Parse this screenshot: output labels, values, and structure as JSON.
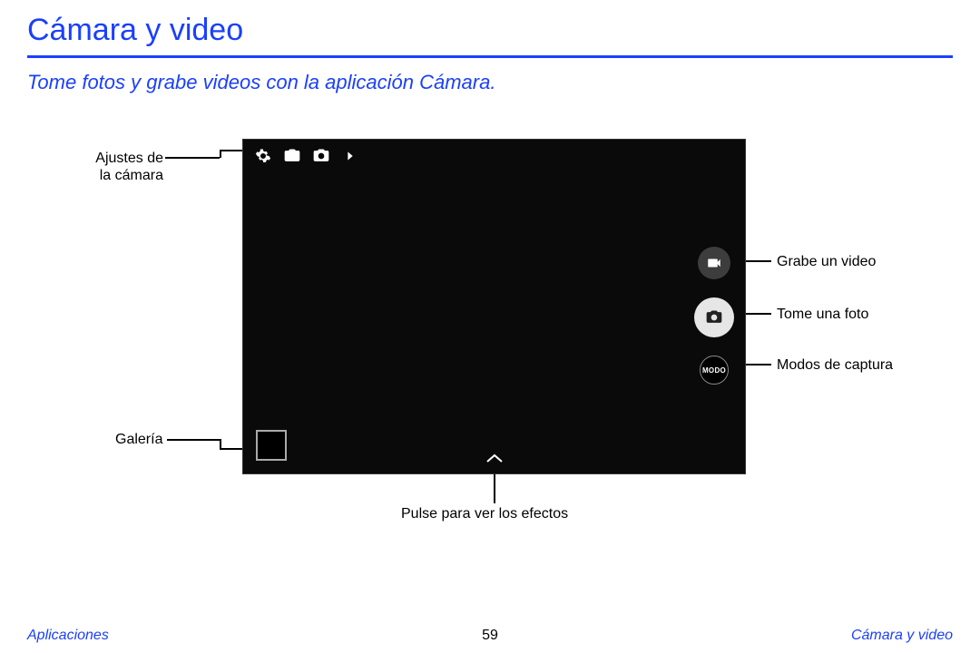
{
  "header": {
    "title": "Cámara y video",
    "subtitle": "Tome fotos y grabe videos con la aplicación Cámara."
  },
  "callouts": {
    "settings": "Ajustes de\nla cámara",
    "gallery": "Galería",
    "effects": "Pulse para ver los efectos",
    "record": "Grabe un video",
    "capture": "Tome una foto",
    "modes": "Modos de captura"
  },
  "camera_ui": {
    "mode_button_label": "MODO"
  },
  "footer": {
    "left": "Aplicaciones",
    "page_number": "59",
    "right": "Cámara y video"
  }
}
